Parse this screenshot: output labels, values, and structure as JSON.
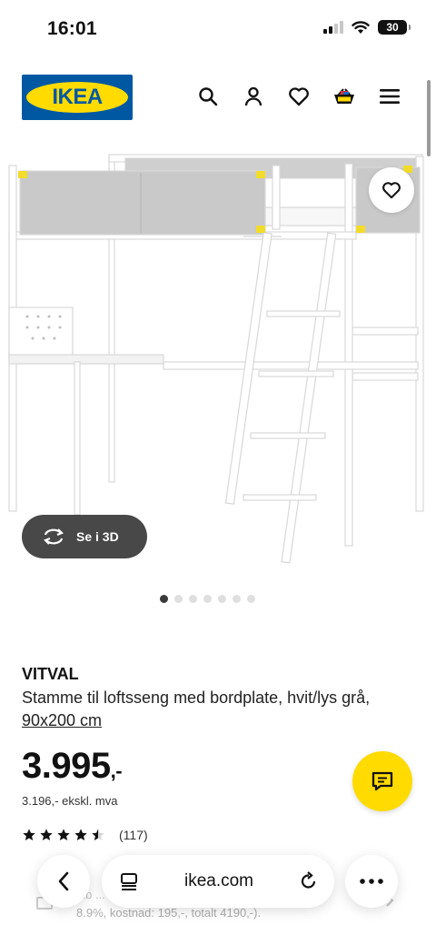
{
  "status_bar": {
    "time": "16:01",
    "battery": "30"
  },
  "header": {
    "logo_text": "IKEA",
    "icons": [
      "search-icon",
      "user-icon",
      "heart-icon",
      "basket-icon",
      "menu-icon"
    ]
  },
  "gallery": {
    "button_3d_label": "Se i 3D",
    "slide_count": 7,
    "active_slide": 1
  },
  "product": {
    "name": "VITVAL",
    "description": "Stamme til loftsseng med bordplate, hvit/lys grå,",
    "size_link": "90x200 cm",
    "price": "3.995",
    "price_suffix": ",-",
    "price_ex_vat": "3.196,- ekskl. mva",
    "rating_value": 4.5,
    "rating_count": "(117)"
  },
  "financing_partial": {
    "line1": "elb ... ... ... ... ...",
    "line2": "8.9%, kostnad: 195,-, totalt 4190,-)."
  },
  "browser_toolbar": {
    "url": "ikea.com"
  },
  "colors": {
    "ikea_blue": "#0058A3",
    "ikea_yellow": "#FFDB00",
    "dark_button": "#484848"
  }
}
